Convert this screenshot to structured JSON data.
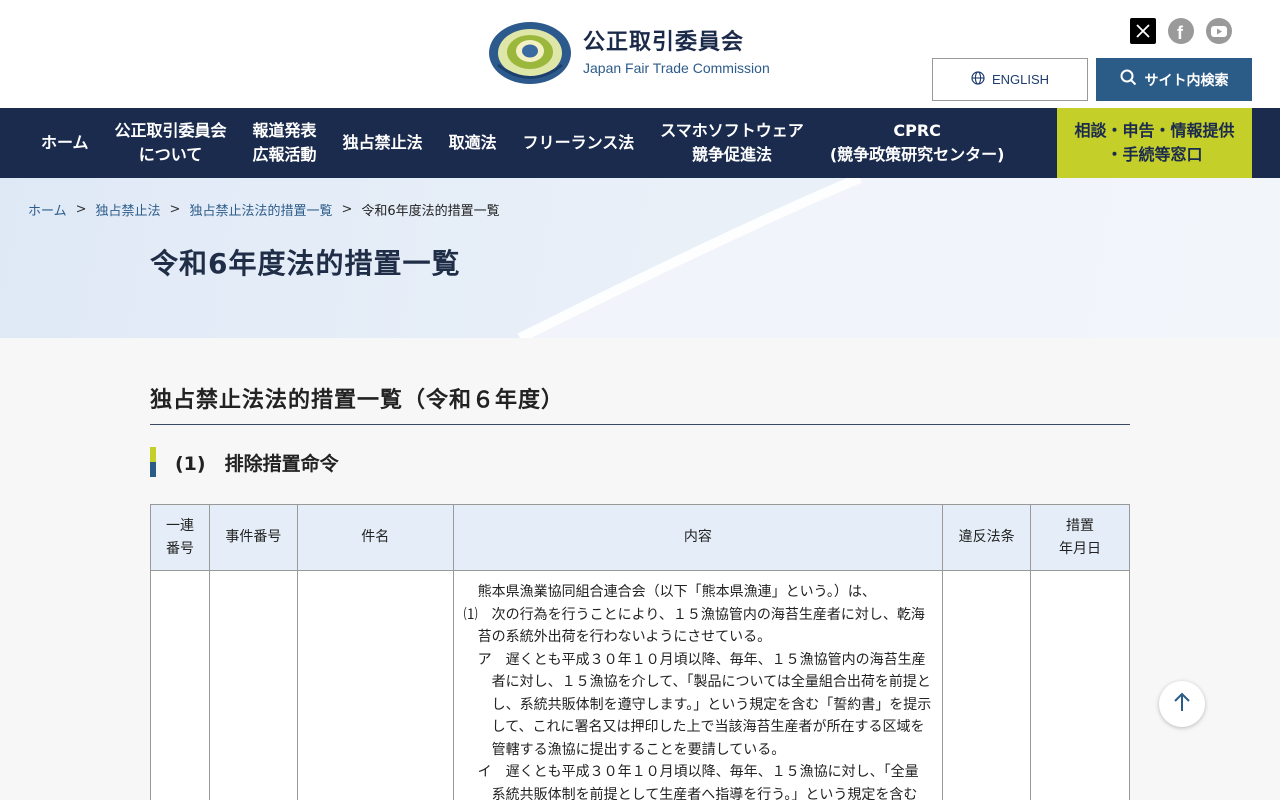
{
  "header": {
    "logo_ja": "公正取引委員会",
    "logo_en": "Japan Fair Trade Commission",
    "english_label": "ENGLISH",
    "search_label": "サイト内検索",
    "social": [
      "x-icon",
      "facebook-icon",
      "youtube-icon"
    ]
  },
  "nav": {
    "items": [
      {
        "label": "ホーム"
      },
      {
        "label": "公正取引委員会\nについて"
      },
      {
        "label": "報道発表\n広報活動"
      },
      {
        "label": "独占禁止法"
      },
      {
        "label": "取適法"
      },
      {
        "label": "フリーランス法"
      },
      {
        "label": "スマホソフトウェア\n競争促進法"
      },
      {
        "label": "CPRC\n(競争政策研究センター)"
      }
    ],
    "consult": "相談・申告・情報提供\n・手続等窓口"
  },
  "breadcrumb": {
    "items": [
      "ホーム",
      "独占禁止法",
      "独占禁止法法的措置一覧"
    ],
    "separator": ">",
    "current": "令和6年度法的措置一覧"
  },
  "page_title": "令和6年度法的措置一覧",
  "section_title": "独占禁止法法的措置一覧（令和６年度）",
  "sub_title": "(1)　排除措置命令",
  "table": {
    "headers": [
      "一連\n番号",
      "事件番号",
      "件名",
      "内容",
      "違反法条",
      "措置\n年月日"
    ],
    "content_lines": [
      {
        "indent": "ind0",
        "text": "熊本県漁業協同組合連合会（以下「熊本県漁連」という。）は、"
      },
      {
        "indent": "ind1",
        "text": "⑴　次の行為を行うことにより、１５漁協管内の海苔生産者に対し、乾海苔の系統外出荷を行わないようにさせている。"
      },
      {
        "indent": "ind2",
        "text": "ア　遅くとも平成３０年１０月頃以降、毎年、１５漁協管内の海苔生産者に対し、１５漁協を介して、「製品については全量組合出荷を前提とし、系統共販体制を遵守します。」という規定を含む「誓約書」を提示して、これに署名又は押印した上で当該海苔生産者が所在する区域を管轄する漁協に提出することを要請している。"
      },
      {
        "indent": "ind2",
        "text": "イ　遅くとも平成３０年１０月頃以降、毎年、１５漁協に対し、「全量系統共販体制を前提として生産者へ指導を行う。」という規定を含む"
      }
    ]
  },
  "colors": {
    "nav_bg": "#1b2b4d",
    "accent": "#c4cf2a",
    "primary": "#2b5b87"
  }
}
